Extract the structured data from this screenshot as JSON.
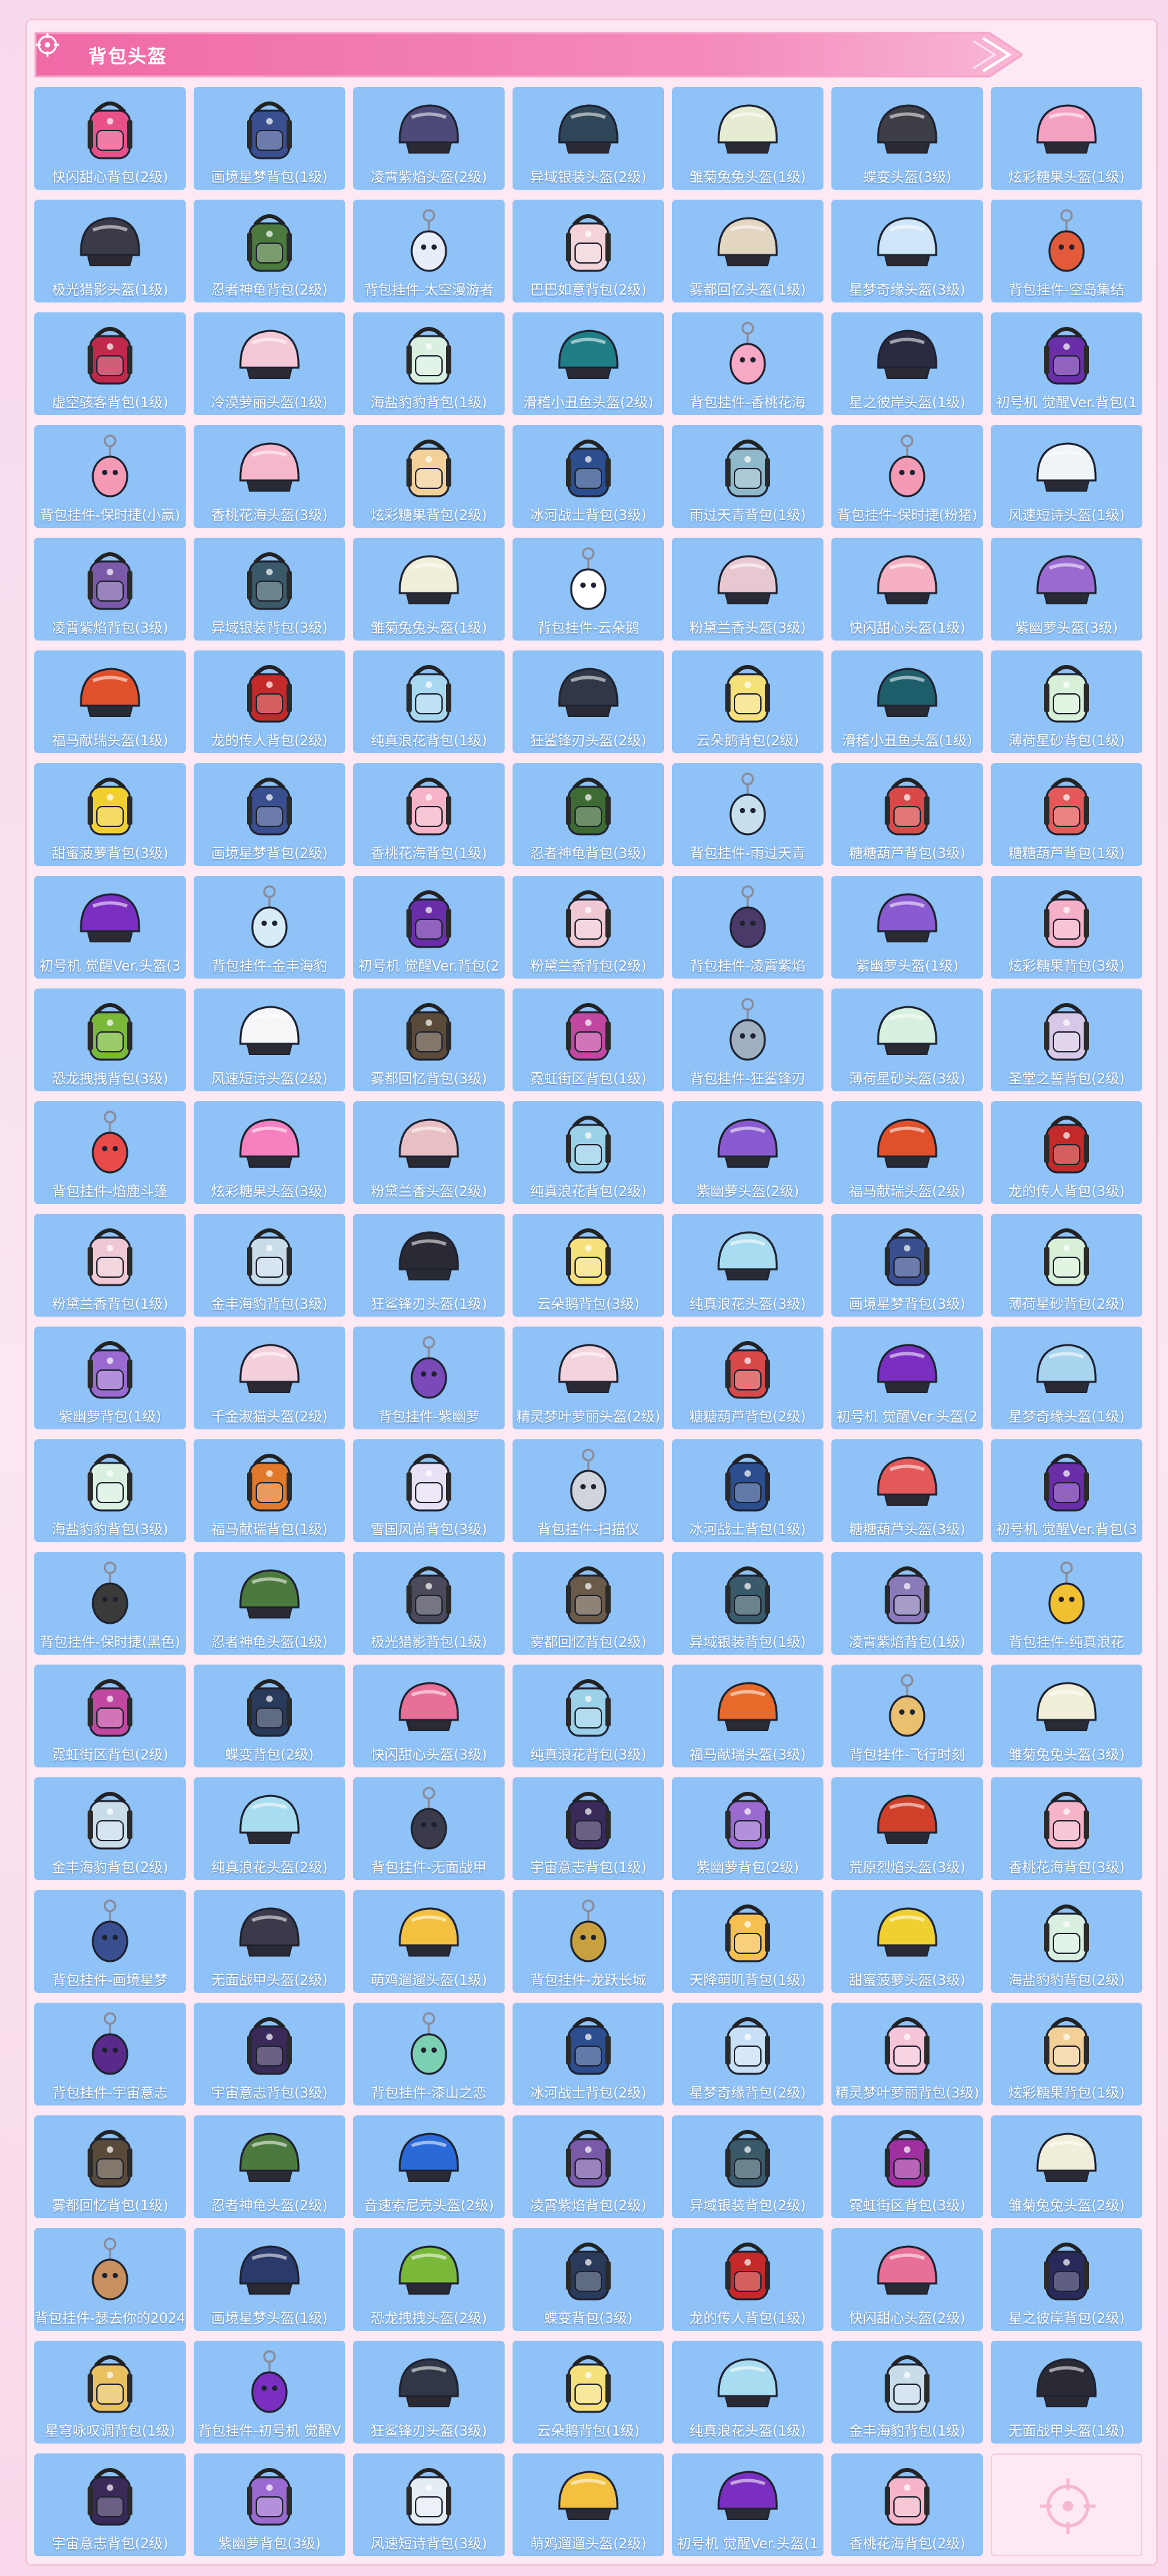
{
  "header": {
    "title": "背包头盔"
  },
  "colors": {
    "card_bg": "#8fc2f6",
    "header_pink": "#f174aa",
    "page_pink": "#fde9f3"
  },
  "items": [
    {
      "label": "快闪甜心背包(2级)",
      "kind": "backpack",
      "color": "#e8508a"
    },
    {
      "label": "画境星梦背包(1级)",
      "kind": "backpack",
      "color": "#3a4f8f"
    },
    {
      "label": "凌霄紫焰头盔(2级)",
      "kind": "helmet",
      "color": "#4d4a78"
    },
    {
      "label": "异域银装头盔(2级)",
      "kind": "helmet",
      "color": "#2f4758"
    },
    {
      "label": "雏菊兔兔头盔(1级)",
      "kind": "helmet",
      "color": "#e6ecd2"
    },
    {
      "label": "蝶变头盔(3级)",
      "kind": "helmet",
      "color": "#3e3e46"
    },
    {
      "label": "炫彩糖果头盔(1级)",
      "kind": "helmet",
      "color": "#f4a0c0"
    },
    {
      "label": "极光猎影头盔(1级)",
      "kind": "helmet",
      "color": "#3a3a48"
    },
    {
      "label": "忍者神龟背包(2级)",
      "kind": "backpack",
      "color": "#4c7a3e"
    },
    {
      "label": "背包挂件-太空漫游者",
      "kind": "charm",
      "color": "#e8eef8"
    },
    {
      "label": "巴巴如意背包(2级)",
      "kind": "backpack",
      "color": "#f3d2d8"
    },
    {
      "label": "雾都回忆头盔(1级)",
      "kind": "helmet",
      "color": "#e2d6c0"
    },
    {
      "label": "星梦奇缘头盔(3级)",
      "kind": "helmet",
      "color": "#cfe6f8"
    },
    {
      "label": "背包挂件-空岛集结",
      "kind": "charm",
      "color": "#e35a3a"
    },
    {
      "label": "虚空骇客背包(1级)",
      "kind": "backpack",
      "color": "#c0284c"
    },
    {
      "label": "冷漠萝丽头盔(1级)",
      "kind": "helmet",
      "color": "#f4c8d6"
    },
    {
      "label": "海盐豹豹背包(1级)",
      "kind": "backpack",
      "color": "#d9f0e0"
    },
    {
      "label": "滑稽小丑鱼头盔(2级)",
      "kind": "helmet",
      "color": "#1f7e86"
    },
    {
      "label": "背包挂件-香桃花海",
      "kind": "charm",
      "color": "#f6a8c4"
    },
    {
      "label": "星之彼岸头盔(1级)",
      "kind": "helmet",
      "color": "#2a2a40"
    },
    {
      "label": "初号机 觉醒Ver.背包(1",
      "kind": "backpack",
      "color": "#6a2fa8"
    },
    {
      "label": "背包挂件-保时捷(小赢)",
      "kind": "charm",
      "color": "#f49ab4"
    },
    {
      "label": "香桃花海头盔(3级)",
      "kind": "helmet",
      "color": "#f7b7cb"
    },
    {
      "label": "炫彩糖果背包(2级)",
      "kind": "backpack",
      "color": "#f2d098"
    },
    {
      "label": "冰河战士背包(3级)",
      "kind": "backpack",
      "color": "#2c4e8e"
    },
    {
      "label": "雨过天青背包(1级)",
      "kind": "backpack",
      "color": "#8fb8c8"
    },
    {
      "label": "背包挂件-保时捷(粉猪)",
      "kind": "charm",
      "color": "#f49ab4"
    },
    {
      "label": "风速短诗头盔(1级)",
      "kind": "helmet",
      "color": "#eef4f8"
    },
    {
      "label": "凌霄紫焰背包(3级)",
      "kind": "backpack",
      "color": "#7a5aa8"
    },
    {
      "label": "异域银装背包(3级)",
      "kind": "backpack",
      "color": "#3a5a6a"
    },
    {
      "label": "雏菊兔兔头盔(1级)",
      "kind": "helmet",
      "color": "#f0eed8"
    },
    {
      "label": "背包挂件-云朵鹅",
      "kind": "charm",
      "color": "#ffffff"
    },
    {
      "label": "粉黛兰香头盔(3级)",
      "kind": "helmet",
      "color": "#e8c8d0"
    },
    {
      "label": "快闪甜心头盔(1级)",
      "kind": "helmet",
      "color": "#f4b0c0"
    },
    {
      "label": "紫幽萝头盔(3级)",
      "kind": "helmet",
      "color": "#9a6ad0"
    },
    {
      "label": "福马献瑞头盔(1级)",
      "kind": "helmet",
      "color": "#e0502a"
    },
    {
      "label": "龙的传人背包(2级)",
      "kind": "backpack",
      "color": "#c42a2a"
    },
    {
      "label": "纯真浪花背包(1级)",
      "kind": "backpack",
      "color": "#a8d8f0"
    },
    {
      "label": "狂鲨锋刃头盔(2级)",
      "kind": "helmet",
      "color": "#303848"
    },
    {
      "label": "云朵鹅背包(2级)",
      "kind": "backpack",
      "color": "#f6e07a"
    },
    {
      "label": "滑稽小丑鱼头盔(1级)",
      "kind": "helmet",
      "color": "#1e5e6a"
    },
    {
      "label": "薄荷星砂背包(1级)",
      "kind": "backpack",
      "color": "#d8f0d8"
    },
    {
      "label": "甜蜜菠萝背包(3级)",
      "kind": "backpack",
      "color": "#f0d030"
    },
    {
      "label": "画境星梦背包(2级)",
      "kind": "backpack",
      "color": "#3a4f8f"
    },
    {
      "label": "香桃花海背包(1级)",
      "kind": "backpack",
      "color": "#f6b4c8"
    },
    {
      "label": "忍者神龟背包(3级)",
      "kind": "backpack",
      "color": "#3e6a34"
    },
    {
      "label": "背包挂件-雨过天青",
      "kind": "charm",
      "color": "#c8e0ee"
    },
    {
      "label": "糖糖葫芦背包(3级)",
      "kind": "backpack",
      "color": "#d84a4a"
    },
    {
      "label": "糖糖葫芦背包(1级)",
      "kind": "backpack",
      "color": "#e45a5a"
    },
    {
      "label": "初号机 觉醒Ver.头盔(3",
      "kind": "helmet",
      "color": "#7a2fc0"
    },
    {
      "label": "背包挂件-金丰海豹",
      "kind": "charm",
      "color": "#d8ecf8"
    },
    {
      "label": "初号机 觉醒Ver.背包(2",
      "kind": "backpack",
      "color": "#6a2fa8"
    },
    {
      "label": "粉黛兰香背包(2级)",
      "kind": "backpack",
      "color": "#f0c8d4"
    },
    {
      "label": "背包挂件-凌霄紫焰",
      "kind": "charm",
      "color": "#4a3a6a"
    },
    {
      "label": "紫幽萝头盔(1级)",
      "kind": "helmet",
      "color": "#8a5ad0"
    },
    {
      "label": "炫彩糖果背包(3级)",
      "kind": "backpack",
      "color": "#f4b0c8"
    },
    {
      "label": "恐龙拽拽背包(3级)",
      "kind": "backpack",
      "color": "#7ab83a"
    },
    {
      "label": "风速短诗头盔(2级)",
      "kind": "helmet",
      "color": "#f4f6f8"
    },
    {
      "label": "雾都回忆背包(3级)",
      "kind": "backpack",
      "color": "#5a4a3a"
    },
    {
      "label": "霓虹街区背包(1级)",
      "kind": "backpack",
      "color": "#c048a0"
    },
    {
      "label": "背包挂件-狂鲨锋刃",
      "kind": "charm",
      "color": "#a0b0c0"
    },
    {
      "label": "薄荷星砂头盔(3级)",
      "kind": "helmet",
      "color": "#d8f0e0"
    },
    {
      "label": "圣堂之誓背包(2级)",
      "kind": "backpack",
      "color": "#d8c8e8"
    },
    {
      "label": "背包挂件-焰鹿斗篷",
      "kind": "charm",
      "color": "#e84a4a"
    },
    {
      "label": "炫彩糖果头盔(3级)",
      "kind": "helmet",
      "color": "#f480c0"
    },
    {
      "label": "粉黛兰香头盔(2级)",
      "kind": "helmet",
      "color": "#e8c0c4"
    },
    {
      "label": "纯真浪花背包(2级)",
      "kind": "backpack",
      "color": "#9ad0e8"
    },
    {
      "label": "紫幽萝头盔(2级)",
      "kind": "helmet",
      "color": "#8a5ad0"
    },
    {
      "label": "福马献瑞头盔(2级)",
      "kind": "helmet",
      "color": "#e0502a"
    },
    {
      "label": "龙的传人背包(3级)",
      "kind": "backpack",
      "color": "#c42a2a"
    },
    {
      "label": "粉黛兰香背包(1级)",
      "kind": "backpack",
      "color": "#f0c8d4"
    },
    {
      "label": "金丰海豹背包(3级)",
      "kind": "backpack",
      "color": "#c8dcea"
    },
    {
      "label": "狂鲨锋刃头盔(1级)",
      "kind": "helmet",
      "color": "#2a2a34"
    },
    {
      "label": "云朵鹅背包(3级)",
      "kind": "backpack",
      "color": "#f6e07a"
    },
    {
      "label": "纯真浪花头盔(3级)",
      "kind": "helmet",
      "color": "#a8dcf0"
    },
    {
      "label": "画境星梦背包(3级)",
      "kind": "backpack",
      "color": "#3a4f8f"
    },
    {
      "label": "薄荷星砂背包(2级)",
      "kind": "backpack",
      "color": "#d8f0d8"
    },
    {
      "label": "紫幽萝背包(1级)",
      "kind": "backpack",
      "color": "#9a6ad0"
    },
    {
      "label": "千金淑猫头盔(2级)",
      "kind": "helmet",
      "color": "#f4d0dc"
    },
    {
      "label": "背包挂件-紫幽萝",
      "kind": "charm",
      "color": "#7a4ab8"
    },
    {
      "label": "精灵梦叶萝丽头盔(2级)",
      "kind": "helmet",
      "color": "#f4d4dc"
    },
    {
      "label": "糖糖葫芦背包(2级)",
      "kind": "backpack",
      "color": "#d84a4a"
    },
    {
      "label": "初号机 觉醒Ver.头盔(2",
      "kind": "helmet",
      "color": "#7a2fc0"
    },
    {
      "label": "星梦奇缘头盔(1级)",
      "kind": "helmet",
      "color": "#a8d4f0"
    },
    {
      "label": "海盐豹豹背包(3级)",
      "kind": "backpack",
      "color": "#d9f0e0"
    },
    {
      "label": "福马献瑞背包(1级)",
      "kind": "backpack",
      "color": "#e07a2a"
    },
    {
      "label": "雪国风尚背包(3级)",
      "kind": "backpack",
      "color": "#e8e0f4"
    },
    {
      "label": "背包挂件-扫描仪",
      "kind": "charm",
      "color": "#d0d4dc"
    },
    {
      "label": "冰河战士背包(1级)",
      "kind": "backpack",
      "color": "#2c4e8e"
    },
    {
      "label": "糖糖葫芦头盔(3级)",
      "kind": "helmet",
      "color": "#e45a5a"
    },
    {
      "label": "初号机 觉醒Ver.背包(3",
      "kind": "backpack",
      "color": "#6a2fa8"
    },
    {
      "label": "背包挂件-保时捷(黑色)",
      "kind": "charm",
      "color": "#3a3a3a"
    },
    {
      "label": "忍者神龟头盔(1级)",
      "kind": "helmet",
      "color": "#4c7a3e"
    },
    {
      "label": "极光猎影背包(1级)",
      "kind": "backpack",
      "color": "#4a4a5a"
    },
    {
      "label": "雾都回忆背包(2级)",
      "kind": "backpack",
      "color": "#6a5a4a"
    },
    {
      "label": "异域银装背包(1级)",
      "kind": "backpack",
      "color": "#3a5a6a"
    },
    {
      "label": "凌霄紫焰背包(1级)",
      "kind": "backpack",
      "color": "#8a7ab8"
    },
    {
      "label": "背包挂件-纯真浪花",
      "kind": "charm",
      "color": "#f0c030"
    },
    {
      "label": "霓虹街区背包(2级)",
      "kind": "backpack",
      "color": "#c048a0"
    },
    {
      "label": "蝶变背包(2级)",
      "kind": "backpack",
      "color": "#2a3a5a"
    },
    {
      "label": "快闪甜心头盔(3级)",
      "kind": "helmet",
      "color": "#e87098"
    },
    {
      "label": "纯真浪花背包(3级)",
      "kind": "backpack",
      "color": "#9ad0e8"
    },
    {
      "label": "福马献瑞头盔(3级)",
      "kind": "helmet",
      "color": "#e86a2a"
    },
    {
      "label": "背包挂件-飞行时刻",
      "kind": "charm",
      "color": "#e8c070"
    },
    {
      "label": "雏菊兔兔头盔(3级)",
      "kind": "helmet",
      "color": "#f0eed8"
    },
    {
      "label": "金丰海豹背包(2级)",
      "kind": "backpack",
      "color": "#c8dcea"
    },
    {
      "label": "纯真浪花头盔(2级)",
      "kind": "helmet",
      "color": "#a8dcf0"
    },
    {
      "label": "背包挂件-无面战甲",
      "kind": "charm",
      "color": "#3a3a4a"
    },
    {
      "label": "宇宙意志背包(1级)",
      "kind": "backpack",
      "color": "#3a2a5a"
    },
    {
      "label": "紫幽萝背包(2级)",
      "kind": "backpack",
      "color": "#9a6ad0"
    },
    {
      "label": "荒原烈焰头盔(3级)",
      "kind": "helmet",
      "color": "#d0402a"
    },
    {
      "label": "香桃花海背包(3级)",
      "kind": "backpack",
      "color": "#f6b4c8"
    },
    {
      "label": "背包挂件-画境星梦",
      "kind": "charm",
      "color": "#3a4f8f"
    },
    {
      "label": "无面战甲头盔(2级)",
      "kind": "helmet",
      "color": "#3a3a4a"
    },
    {
      "label": "萌鸡遛遛头盔(1级)",
      "kind": "helmet",
      "color": "#f4c040"
    },
    {
      "label": "背包挂件-龙跃长城",
      "kind": "charm",
      "color": "#c8a040"
    },
    {
      "label": "天降萌叽背包(1级)",
      "kind": "backpack",
      "color": "#f6c050"
    },
    {
      "label": "甜蜜菠萝头盔(3级)",
      "kind": "helmet",
      "color": "#f0d030"
    },
    {
      "label": "海盐豹豹背包(2级)",
      "kind": "backpack",
      "color": "#d9f0e0"
    },
    {
      "label": "背包挂件-宇宙意志",
      "kind": "charm",
      "color": "#5a2a8a"
    },
    {
      "label": "宇宙意志背包(3级)",
      "kind": "backpack",
      "color": "#3a2a5a"
    },
    {
      "label": "背包挂件-漆山之恋",
      "kind": "charm",
      "color": "#7ad0b0"
    },
    {
      "label": "冰河战士背包(2级)",
      "kind": "backpack",
      "color": "#2c4e8e"
    },
    {
      "label": "星梦奇缘背包(2级)",
      "kind": "backpack",
      "color": "#c8e0f6"
    },
    {
      "label": "精灵梦叶萝丽背包(3级)",
      "kind": "backpack",
      "color": "#f4c4d8"
    },
    {
      "label": "炫彩糖果背包(1级)",
      "kind": "backpack",
      "color": "#f2d098"
    },
    {
      "label": "雾都回忆背包(1级)",
      "kind": "backpack",
      "color": "#5a4a3a"
    },
    {
      "label": "忍者神龟头盔(2级)",
      "kind": "helmet",
      "color": "#4c7a3e"
    },
    {
      "label": "音速索尼克头盔(2级)",
      "kind": "helmet",
      "color": "#2a6ad8"
    },
    {
      "label": "凌霄紫焰背包(2级)",
      "kind": "backpack",
      "color": "#7a5aa8"
    },
    {
      "label": "异域银装背包(2级)",
      "kind": "backpack",
      "color": "#3a5a6a"
    },
    {
      "label": "霓虹街区背包(3级)",
      "kind": "backpack",
      "color": "#a030a0"
    },
    {
      "label": "雏菊兔兔头盔(2级)",
      "kind": "helmet",
      "color": "#f0eed8"
    },
    {
      "label": "背包挂件-瑟去你的2024",
      "kind": "charm",
      "color": "#c89060"
    },
    {
      "label": "画境星梦头盔(1级)",
      "kind": "helmet",
      "color": "#2a3a6a"
    },
    {
      "label": "恐龙拽拽头盔(2级)",
      "kind": "helmet",
      "color": "#7ab83a"
    },
    {
      "label": "蝶变背包(3级)",
      "kind": "backpack",
      "color": "#2a3a5a"
    },
    {
      "label": "龙的传人背包(1级)",
      "kind": "backpack",
      "color": "#c42a2a"
    },
    {
      "label": "快闪甜心头盔(2级)",
      "kind": "helmet",
      "color": "#e87098"
    },
    {
      "label": "星之彼岸背包(2级)",
      "kind": "backpack",
      "color": "#2a2a5a"
    },
    {
      "label": "星穹咏叹调背包(1级)",
      "kind": "backpack",
      "color": "#e8c060"
    },
    {
      "label": "背包挂件-初号机 觉醒V",
      "kind": "charm",
      "color": "#7a2fc0"
    },
    {
      "label": "狂鲨锋刃头盔(3级)",
      "kind": "helmet",
      "color": "#303848"
    },
    {
      "label": "云朵鹅背包(1级)",
      "kind": "backpack",
      "color": "#f6e07a"
    },
    {
      "label": "纯真浪花头盔(1级)",
      "kind": "helmet",
      "color": "#a8dcf0"
    },
    {
      "label": "金丰海豹背包(1级)",
      "kind": "backpack",
      "color": "#c8dcea"
    },
    {
      "label": "无面战甲头盔(1级)",
      "kind": "helmet",
      "color": "#2a2a34"
    },
    {
      "label": "宇宙意志背包(2级)",
      "kind": "backpack",
      "color": "#3a2a5a"
    },
    {
      "label": "紫幽萝背包(3级)",
      "kind": "backpack",
      "color": "#9a6ad0"
    },
    {
      "label": "风速短诗背包(3级)",
      "kind": "backpack",
      "color": "#e4ecf4"
    },
    {
      "label": "萌鸡遛遛头盔(2级)",
      "kind": "helmet",
      "color": "#f4c040"
    },
    {
      "label": "初号机 觉醒Ver.头盔(1",
      "kind": "helmet",
      "color": "#7a2fc0"
    },
    {
      "label": "香桃花海背包(2级)",
      "kind": "backpack",
      "color": "#f6b4c8"
    },
    {
      "label": "",
      "kind": "empty",
      "color": "#f5b8d2"
    }
  ]
}
